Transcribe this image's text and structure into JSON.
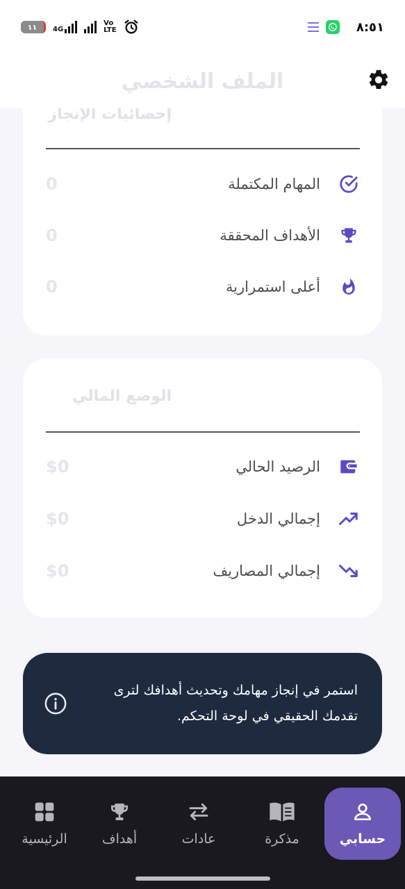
{
  "status_bar": {
    "time": "٨:٥١",
    "battery": "١١",
    "network": "4G",
    "volte_top": "Vo",
    "volte_bottom": "LTE"
  },
  "header": {
    "title": "الملف الشخصي"
  },
  "achievements": {
    "title": "إحصائيات الإنجاز",
    "rows": [
      {
        "label": "المهام المكتملة",
        "value": "0",
        "icon": "check-circle-icon"
      },
      {
        "label": "الأهداف المحققة",
        "value": "0",
        "icon": "trophy-icon"
      },
      {
        "label": "أعلى استمرارية",
        "value": "0",
        "icon": "flame-icon"
      }
    ]
  },
  "finance": {
    "title": "الوضع المالي",
    "rows": [
      {
        "label": "الرصيد الحالي",
        "value": "$0",
        "icon": "wallet-icon"
      },
      {
        "label": "إجمالي الدخل",
        "value": "$0",
        "icon": "trending-up-icon"
      },
      {
        "label": "إجمالي المصاريف",
        "value": "$0",
        "icon": "trending-down-icon"
      }
    ]
  },
  "info_banner": {
    "line1": "استمر في إنجاز مهامك وتحديث أهدافك لترى",
    "line2": "تقدمك الحقيقي في لوحة التحكم."
  },
  "bottom_nav": {
    "items": [
      {
        "label": "حسابي",
        "icon": "person-icon",
        "active": true
      },
      {
        "label": "مذكرة",
        "icon": "book-icon",
        "active": false
      },
      {
        "label": "عادات",
        "icon": "swap-arrows-icon",
        "active": false
      },
      {
        "label": "أهداف",
        "icon": "trophy-icon",
        "active": false
      },
      {
        "label": "الرئيسية",
        "icon": "grid-icon",
        "active": false
      }
    ]
  },
  "colors": {
    "accent": "#6b59b5",
    "icon_accent": "#5b4bc4",
    "banner_bg": "#1e2a3e",
    "nav_bg": "#1a191f"
  }
}
